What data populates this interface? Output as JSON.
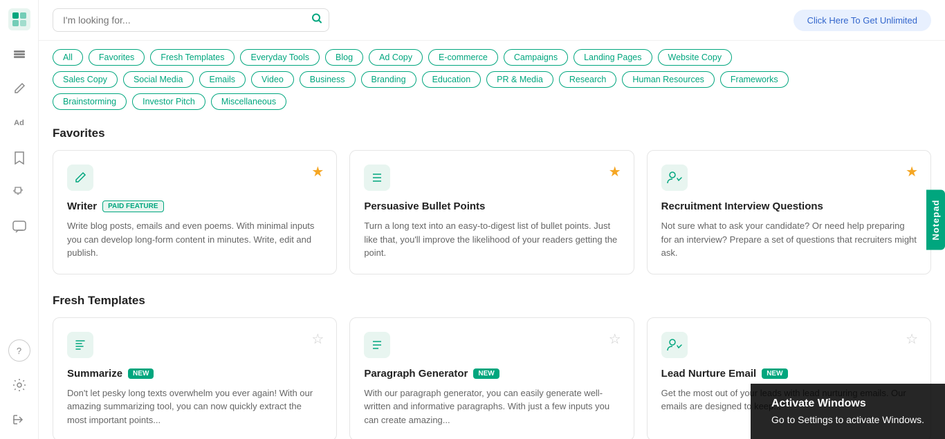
{
  "sidebar": {
    "icons": [
      {
        "name": "logo-icon",
        "symbol": "⊞",
        "active": true
      },
      {
        "name": "layers-icon",
        "symbol": "⧉",
        "active": false
      },
      {
        "name": "edit-icon",
        "symbol": "✏",
        "active": false
      },
      {
        "name": "ad-icon",
        "symbol": "Ad",
        "active": false
      },
      {
        "name": "bookmark-icon",
        "symbol": "🔖",
        "active": false
      },
      {
        "name": "puzzle-icon",
        "symbol": "⊕",
        "active": false
      },
      {
        "name": "chat-icon",
        "symbol": "💬",
        "active": false
      },
      {
        "name": "help-icon",
        "symbol": "?",
        "active": false
      }
    ],
    "bottom_icons": [
      {
        "name": "settings-icon",
        "symbol": "⚙",
        "active": false
      },
      {
        "name": "logout-icon",
        "symbol": "→",
        "active": false
      }
    ]
  },
  "topbar": {
    "search_placeholder": "I'm looking for...",
    "cta_label": "Click Here To Get Unlimited"
  },
  "filters": {
    "row1": [
      "All",
      "Favorites",
      "Fresh Templates",
      "Everyday Tools",
      "Blog",
      "Ad Copy",
      "E-commerce",
      "Campaigns",
      "Landing Pages",
      "Website Copy"
    ],
    "row2": [
      "Sales Copy",
      "Social Media",
      "Emails",
      "Video",
      "Business",
      "Branding",
      "Education",
      "PR & Media",
      "Research",
      "Human Resources",
      "Frameworks"
    ],
    "row3": [
      "Brainstorming",
      "Investor Pitch",
      "Miscellaneous"
    ]
  },
  "favorites_section": {
    "title": "Favorites",
    "cards": [
      {
        "icon": "✏",
        "icon_style": "green",
        "title": "Writer",
        "badge": "PAID FEATURE",
        "badge_type": "paid",
        "starred": true,
        "desc": "Write blog posts, emails and even poems. With minimal inputs you can develop long-form content in minutes. Write, edit and publish."
      },
      {
        "icon": "≡",
        "icon_style": "green",
        "title": "Persuasive Bullet Points",
        "badge": "",
        "badge_type": "",
        "starred": true,
        "desc": "Turn a long text into an easy-to-digest list of bullet points. Just like that, you'll improve the likelihood of your readers getting the point."
      },
      {
        "icon": "👥",
        "icon_style": "green",
        "title": "Recruitment Interview Questions",
        "badge": "",
        "badge_type": "",
        "starred": true,
        "desc": "Not sure what to ask your candidate? Or need help preparing for an interview? Prepare a set of questions that recruiters might ask."
      }
    ]
  },
  "fresh_section": {
    "title": "Fresh Templates",
    "cards": [
      {
        "icon": "✂",
        "icon_style": "green",
        "title": "Summarize",
        "badge": "NEW",
        "badge_type": "new",
        "starred": false,
        "desc": "Don't let pesky long texts overwhelm you ever again! With our amazing summarizing tool, you can now quickly extract the most important points..."
      },
      {
        "icon": "≡",
        "icon_style": "green",
        "title": "Paragraph Generator",
        "badge": "NEW",
        "badge_type": "new",
        "starred": false,
        "desc": "With our paragraph generator, you can easily generate well-written and informative paragraphs. With just a few inputs you can create amazing..."
      },
      {
        "icon": "👥",
        "icon_style": "green",
        "title": "Lead Nurture Email",
        "badge": "NEW",
        "badge_type": "new",
        "starred": false,
        "desc": "Get the most out of your leads with lead nurturing emails. Our emails are designed to keep..."
      }
    ]
  },
  "notepad": {
    "label": "Notepad"
  },
  "activate": {
    "title": "Activate Windows",
    "body": "Go to Settings to activate Windows."
  }
}
